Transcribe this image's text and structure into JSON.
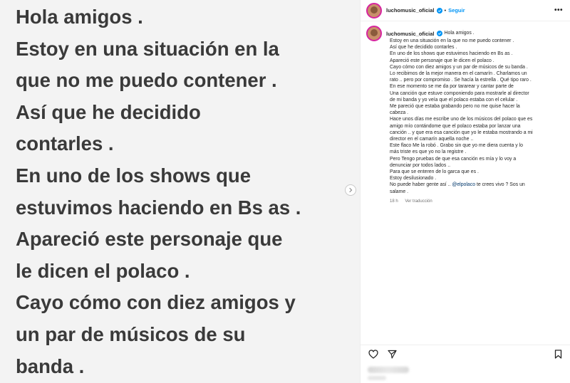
{
  "image": {
    "lines": [
      "Hola amigos .",
      "Estoy en una situación en la",
      "que no me puedo contener .",
      "Así que he decidido",
      "contarles .",
      "En uno de los shows que",
      "estuvimos haciendo en Bs as .",
      "Apareció este  personaje que",
      "le dicen el polaco .",
      "Cayo cómo con diez amigos y",
      "un par de músicos de su",
      "banda ."
    ]
  },
  "post": {
    "username": "luchomusic_oficial",
    "separator": "•",
    "follow_label": "Seguir",
    "more_label": "•••",
    "caption_first": "Hola amigos .",
    "caption_lines": [
      "Estoy en una situación en la que no me puedo contener .",
      "Así que he decidido contarles .",
      "En uno de los shows que estuvimos haciendo en Bs as .",
      "Apareció este personaje que le dicen el polaco .",
      "Cayo cómo con diez amigos y un par de músicos de su banda .",
      "Lo recibimos de la mejor manera en el camarín . Charlamos un",
      "rato .. pero por compromiso . Se hacía la estrella . Qué tipo raro .",
      "En ese momento se me da por tararear y cantar parte de",
      "Una canción que estuve componiendo para mostrarle al director",
      "de mi banda y yo veía que el polaco estaba con el celular .",
      "Me pareció que estaba grabando pero no me quise hacer la",
      "cabeza .",
      "Hace unos días me escribe uno de los músicos del polaco que es",
      "amigo mío contándome que el polaco estaba por lanzar una",
      "canción .. y que era esa canción que yo le estaba mostrando a mi",
      "director en el camarín aquella noche ..",
      "Este flaco Me la robó . Grabo sin que yo me diera cuenta y lo",
      "más triste es que yo no la registre .",
      "Pero Tengo pruebas de que esa canción es mía y lo voy a",
      "denunciar por todos lados ..",
      "Para que se enteren de lo garca que es .",
      "Estoy desilusionado ."
    ],
    "caption_mention_line": {
      "before": "No puede haber gente así .. ",
      "mention": "@elpolaco",
      "after": " te crees vivo ? Sos un"
    },
    "caption_last": "salame .",
    "time_ago": "18 h",
    "translate_label": "Ver traducción"
  },
  "icons": {
    "verified": "verified-badge-icon",
    "more": "more-options-icon",
    "heart": "heart-icon",
    "share": "paper-plane-icon",
    "bookmark": "bookmark-icon",
    "next": "chevron-right-icon"
  },
  "colors": {
    "accent": "#0095f6",
    "mention": "#00376b",
    "image_bg": "#f3f3f3",
    "image_text": "#3a3a3a"
  }
}
